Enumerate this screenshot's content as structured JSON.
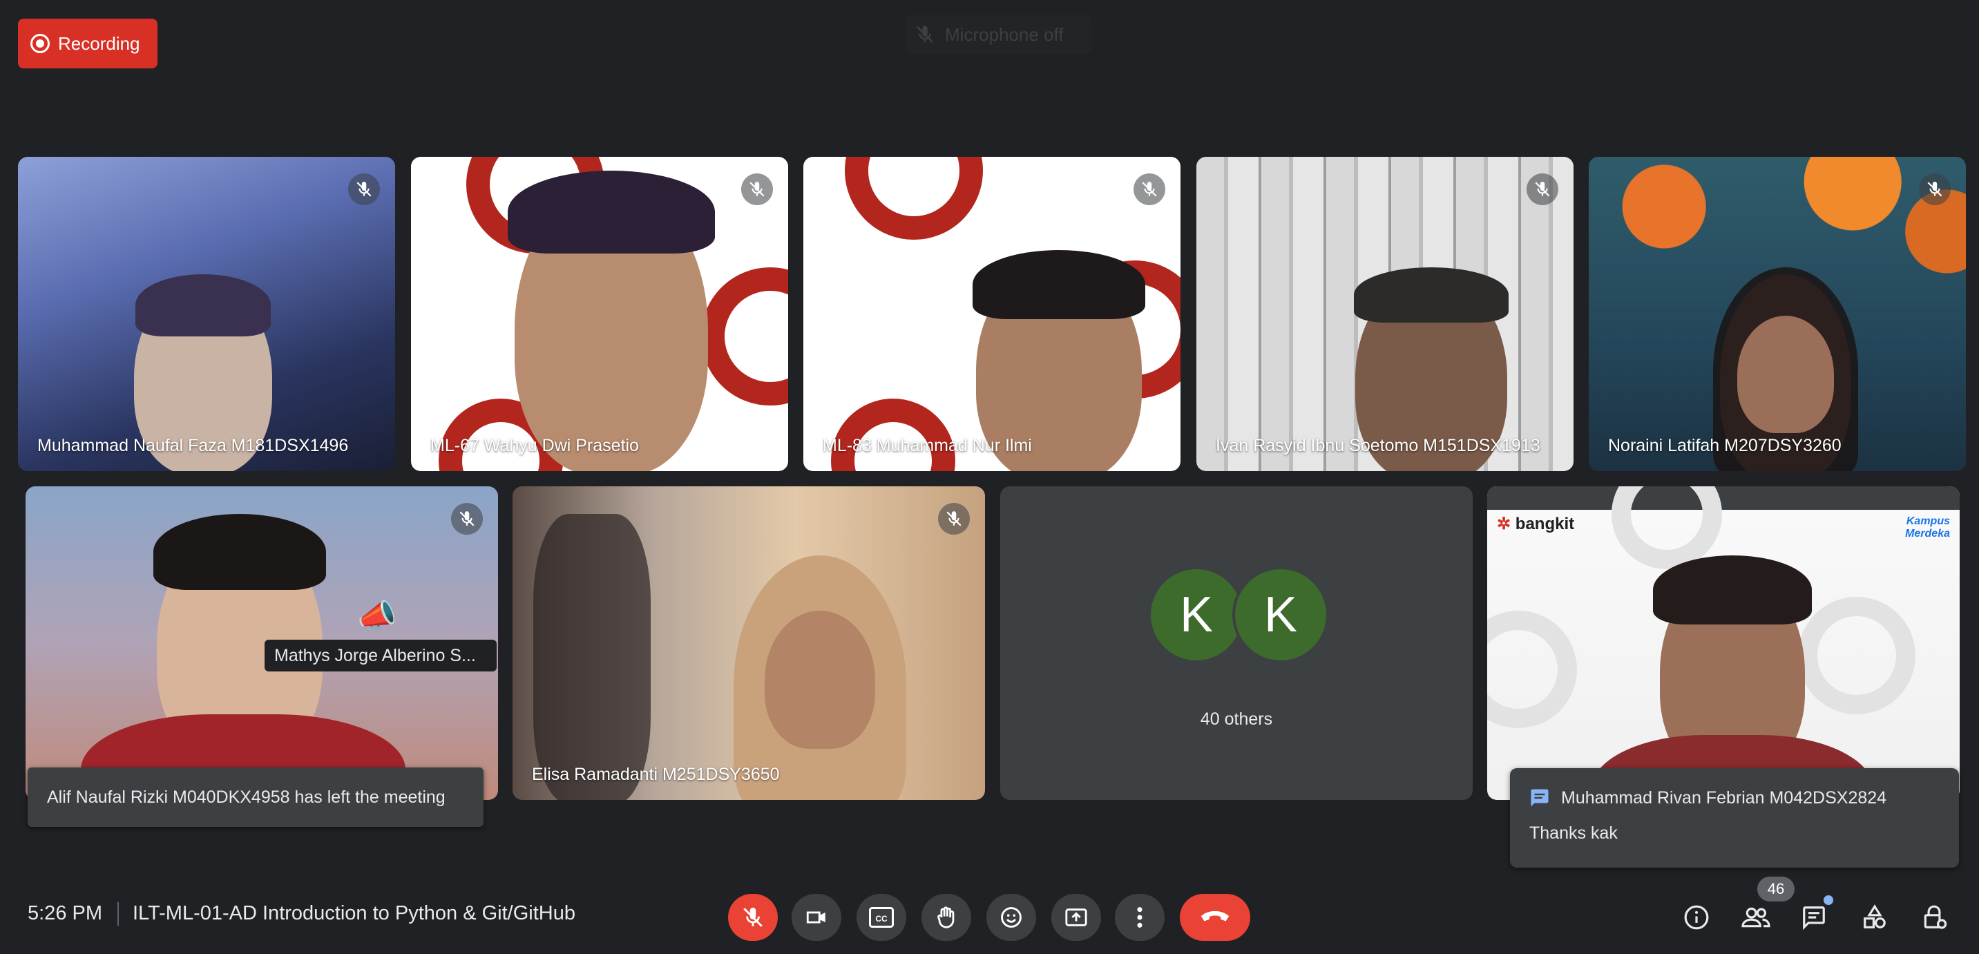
{
  "recording": {
    "label": "Recording"
  },
  "notice": {
    "label": "Microphone off"
  },
  "participants": [
    {
      "name": "Muhammad Naufal Faza M181DSX1496",
      "muted": true
    },
    {
      "name": "ML-67 Wahyu Dwi Prasetio",
      "muted": true
    },
    {
      "name": "ML-83 Muhammad Nur Ilmi",
      "muted": true
    },
    {
      "name": "Ivan Rasyid Ibnu Soetomo M151DSX1913",
      "muted": true
    },
    {
      "name": "Noraini Latifah M207DSY3260",
      "muted": true
    },
    {
      "name": "Mathys Jorge Alberino S...",
      "muted": true
    },
    {
      "name": "Elisa Ramadanti M251DSY3650",
      "muted": true
    },
    {
      "name": "Muhammad Rivan Febrian M042DSX2824",
      "muted": false
    }
  ],
  "others_tile": {
    "avatars": [
      "K",
      "K"
    ],
    "label": "40 others"
  },
  "presenter_tile": {
    "brand": "bangkit",
    "partner": "Kampus Merdeka"
  },
  "toast": {
    "text": "Alif Naufal Rizki M040DKX4958 has left the meeting"
  },
  "chat_popup": {
    "sender": "Muhammad Rivan Febrian M042DSX2824",
    "message": "Thanks kak"
  },
  "bottom_bar": {
    "time": "5:26 PM",
    "meeting_title": "ILT-ML-01-AD Introduction to Python & Git/GitHub",
    "participant_count": "46",
    "colors": {
      "end_call": "#ea4335",
      "mic_off": "#ea4335",
      "badge": "#5f6368",
      "chat_dot": "#8ab4f8"
    },
    "controls": [
      "mic-off-icon",
      "camera-icon",
      "captions-icon",
      "raise-hand-icon",
      "emoji-icon",
      "present-icon",
      "more-options-icon",
      "end-call-icon"
    ],
    "right_icons": [
      "info-icon",
      "people-icon",
      "chat-icon",
      "activities-icon",
      "host-controls-icon"
    ]
  }
}
